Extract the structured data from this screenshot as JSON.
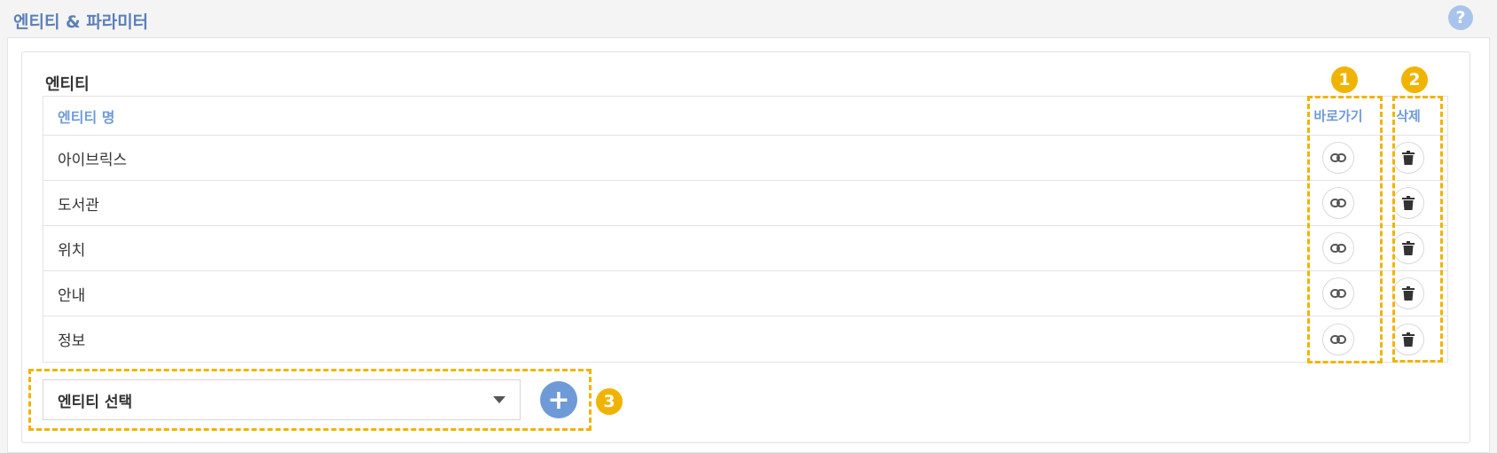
{
  "page": {
    "section_title": "엔티티 & 파라미터",
    "help_icon": "?"
  },
  "entities": {
    "label": "엔티티",
    "header": {
      "name": "엔티티 명",
      "link": "바로가기",
      "delete": "삭제"
    },
    "rows": [
      {
        "name": "아이브릭스"
      },
      {
        "name": "도서관"
      },
      {
        "name": "위치"
      },
      {
        "name": "안내"
      },
      {
        "name": "정보"
      }
    ]
  },
  "selector": {
    "placeholder": "엔티티 선택",
    "add_symbol": "+"
  },
  "markers": [
    "1",
    "2",
    "3"
  ],
  "icons": {
    "link": "link-icon",
    "delete": "trash-icon",
    "help": "question-icon",
    "dropdown": "caret-down-icon"
  },
  "colors": {
    "accent": "#6e9bd8",
    "highlight": "#f0b400",
    "title": "#5b7fb8"
  }
}
